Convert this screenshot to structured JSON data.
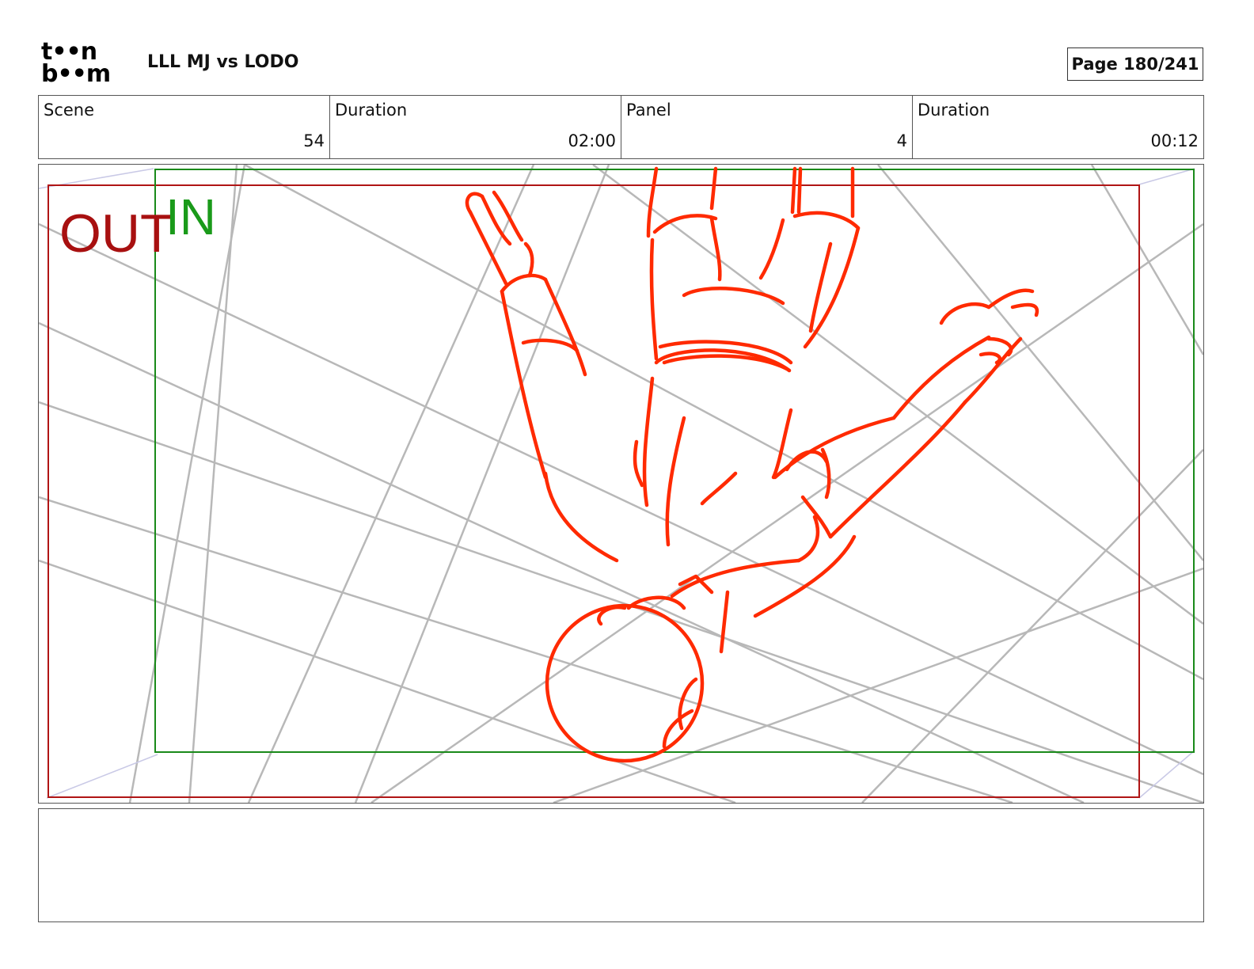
{
  "header": {
    "logo_line1": "t••n",
    "logo_line2": "b••m",
    "project_title": "LLL MJ vs LODO",
    "page_label": "Page 180/241"
  },
  "info": [
    {
      "label": "Scene",
      "value": "54"
    },
    {
      "label": "Duration",
      "value": "02:00"
    },
    {
      "label": "Panel",
      "value": "4"
    },
    {
      "label": "Duration",
      "value": "00:12"
    }
  ],
  "panel": {
    "out_label": "OUT",
    "in_label": "IN",
    "colors": {
      "out_frame": "#b01515",
      "in_frame": "#1a8a1a",
      "sketch": "#ff2a00",
      "guides": "#b8b8b8"
    }
  },
  "notes": ""
}
